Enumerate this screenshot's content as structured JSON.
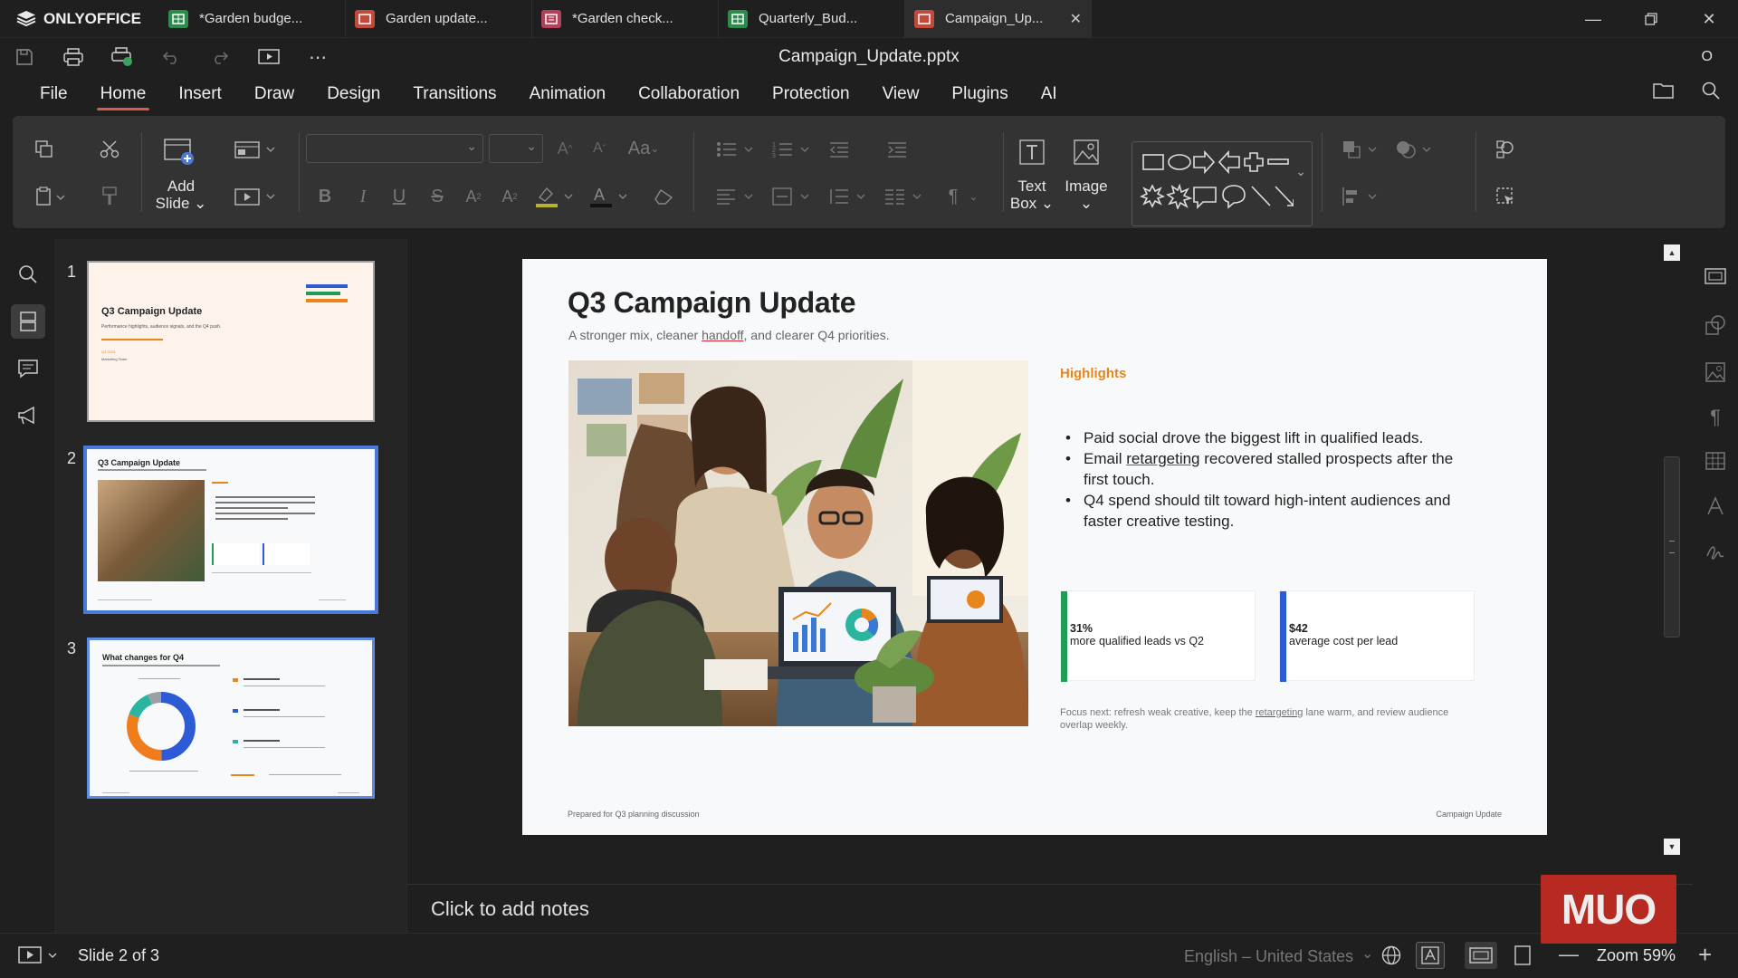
{
  "app": {
    "name": "ONLYOFFICE"
  },
  "tabs": [
    {
      "label": "*Garden budge...",
      "type": "sheet"
    },
    {
      "label": "Garden update...",
      "type": "slides"
    },
    {
      "label": "*Garden check...",
      "type": "form"
    },
    {
      "label": "Quarterly_Bud...",
      "type": "sheet"
    },
    {
      "label": "Campaign_Up...",
      "type": "slides",
      "active": true
    }
  ],
  "document": {
    "title": "Campaign_Update.pptx",
    "user_initial": "O"
  },
  "menu": [
    "File",
    "Home",
    "Insert",
    "Draw",
    "Design",
    "Transitions",
    "Animation",
    "Collaboration",
    "Protection",
    "View",
    "Plugins",
    "AI"
  ],
  "menu_active": "Home",
  "ribbon": {
    "add_slide_line1": "Add",
    "add_slide_line2": "Slide",
    "text_box_line1": "Text",
    "text_box_line2": "Box",
    "image": "Image"
  },
  "colors": {
    "accent": "#d9594c",
    "selection": "#4a79d6",
    "highlight_orange": "#e8851b",
    "stat_green": "#1f9d55",
    "stat_blue": "#2d5bd6"
  },
  "thumbnails": [
    {
      "number": "1",
      "title": "Q3 Campaign Update",
      "subtitle": "Performance highlights, audience signals, and the Q4 push.",
      "meta1": "Q3 2024",
      "meta2": "Marketing Team"
    },
    {
      "number": "2",
      "title": "Q3 Campaign Update",
      "selected": true
    },
    {
      "number": "3",
      "title": "What changes for Q4"
    }
  ],
  "slide": {
    "title": "Q3 Campaign Update",
    "subtitle_pre": "A stronger mix, cleaner ",
    "subtitle_err": "handoff",
    "subtitle_post": ", and clearer Q4 priorities.",
    "highlights_label": "Highlights",
    "bullet1": "Paid social drove the biggest lift in qualified leads.",
    "bullet2_pre": "Email ",
    "bullet2_err": "retargeting",
    "bullet2_post": " recovered stalled prospects after the first touch.",
    "bullet3": "Q4 spend should tilt toward high-intent audiences and faster creative testing.",
    "stat1_value": "31%",
    "stat1_label": "more qualified leads vs Q2",
    "stat2_value": "$42",
    "stat2_label": "average cost per lead",
    "focus_pre": "Focus next: refresh weak creative, keep the ",
    "focus_err": "retargeting",
    "focus_post": " lane warm, and review audience overlap weekly.",
    "footer_left": "Prepared for Q3 planning discussion",
    "footer_right": "Campaign Update"
  },
  "notes_placeholder": "Click to add notes",
  "status": {
    "slide_counter": "Slide 2 of 3",
    "language": "English – United States",
    "zoom": "Zoom 59%"
  },
  "watermark": "MUO"
}
